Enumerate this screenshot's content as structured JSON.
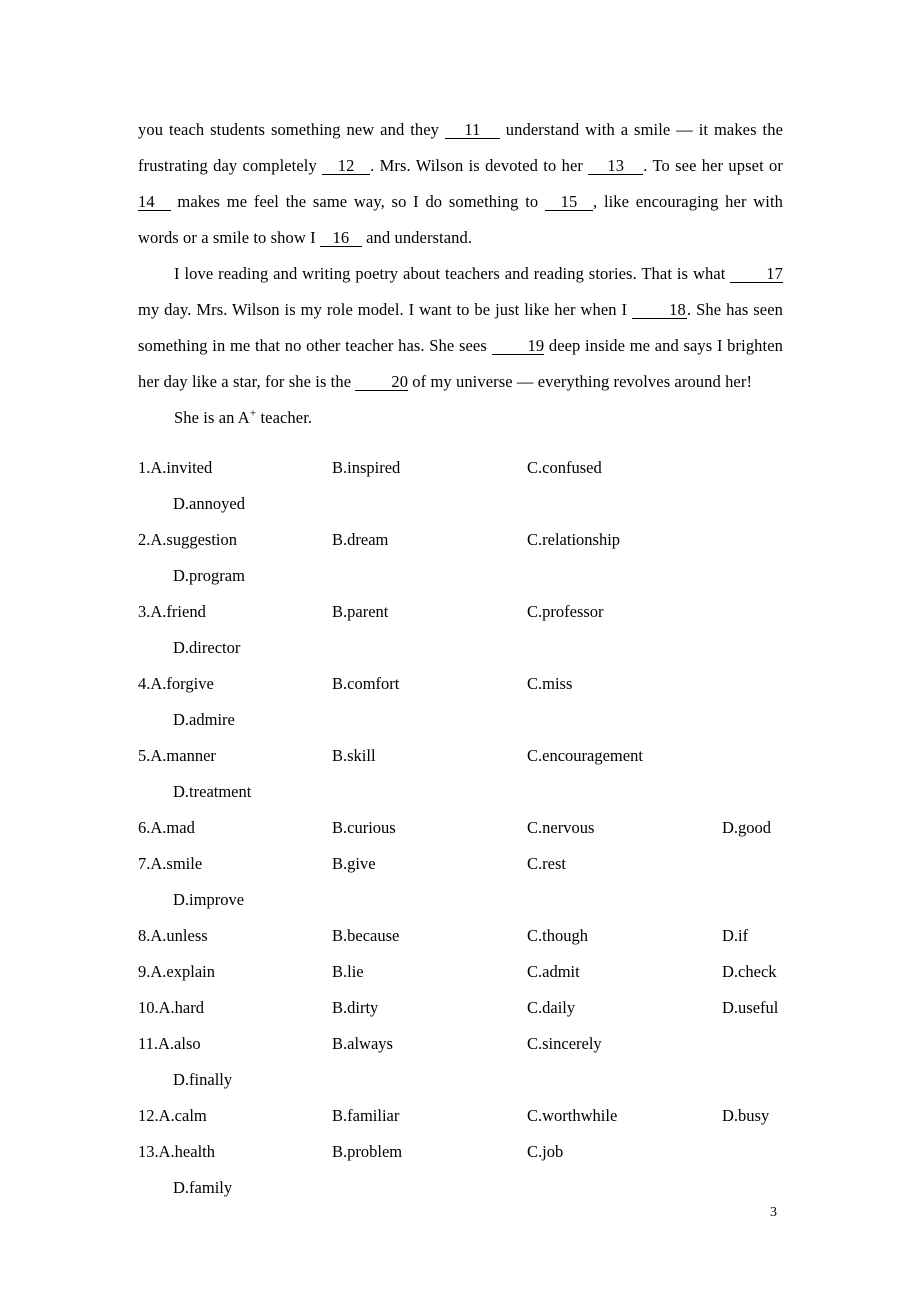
{
  "page": {
    "number": "3"
  },
  "passage": {
    "paragraphs": [
      {
        "id": "p1-continued",
        "indent": false,
        "segments": [
          {
            "type": "text",
            "text": "you teach students something new and they "
          },
          {
            "type": "blank",
            "label": "11",
            "width": "w55"
          },
          {
            "type": "text",
            "text": " understand with a smile — it makes the frustrating day completely "
          },
          {
            "type": "blank",
            "label": "12",
            "width": "w48"
          },
          {
            "type": "text",
            "text": ". Mrs. Wilson is devoted to her "
          },
          {
            "type": "blank",
            "label": "13",
            "width": "w55"
          },
          {
            "type": "text",
            "text": ". To see her upset or "
          },
          {
            "type": "blank",
            "label": "14",
            "width": "lead"
          },
          {
            "type": "text",
            "text": " makes me feel the same way, so I do something to "
          },
          {
            "type": "blank",
            "label": "15",
            "width": "w48"
          },
          {
            "type": "text",
            "text": ", like encouraging her with words or a smile to show I "
          },
          {
            "type": "blank",
            "label": "16",
            "width": "w42"
          },
          {
            "type": "text",
            "text": " and understand."
          }
        ]
      },
      {
        "id": "p2",
        "indent": true,
        "segments": [
          {
            "type": "text",
            "text": "I love reading and writing poetry about teachers and reading stories. That is what "
          },
          {
            "type": "blank",
            "label": "17",
            "width": "w48"
          },
          {
            "type": "text",
            "text": " my day. Mrs. Wilson is my role model. I want to be just like her when I "
          },
          {
            "type": "blank",
            "label": "18",
            "width": "w55"
          },
          {
            "type": "text",
            "text": ". She has seen something in me that no other teacher has. She sees "
          },
          {
            "type": "blank",
            "label": "19",
            "width": "w48"
          },
          {
            "type": "text",
            "text": " deep inside me and says I brighten her day like a star, for she is the "
          },
          {
            "type": "blank",
            "label": "20",
            "width": "w48"
          },
          {
            "type": "text",
            "text": " of my universe — everything revolves around her!"
          }
        ]
      },
      {
        "id": "p3",
        "indent": true,
        "segments": [
          {
            "type": "text",
            "text": "She is an A"
          },
          {
            "type": "sup",
            "text": "+"
          },
          {
            "type": "text",
            "text": " teacher."
          }
        ]
      }
    ]
  },
  "questions": [
    {
      "number": "1",
      "a": "1.A.invited",
      "b": "B.inspired",
      "c": "C.confused",
      "d": "D.annoyed",
      "d_wraps": true
    },
    {
      "number": "2",
      "a": "2.A.suggestion",
      "b": "B.dream",
      "c": "C.relationship",
      "d": "D.program",
      "d_wraps": true
    },
    {
      "number": "3",
      "a": "3.A.friend",
      "b": "B.parent",
      "c": "C.professor",
      "d": "D.director",
      "d_wraps": true
    },
    {
      "number": "4",
      "a": "4.A.forgive",
      "b": "B.comfort",
      "c": "C.miss",
      "d": "D.admire",
      "d_wraps": true
    },
    {
      "number": "5",
      "a": "5.A.manner",
      "b": "B.skill",
      "c": "C.encouragement",
      "d": "D.treatment",
      "d_wraps": true
    },
    {
      "number": "6",
      "a": "6.A.mad",
      "b": "B.curious",
      "c": "C.nervous",
      "d": "D.good",
      "d_wraps": false
    },
    {
      "number": "7",
      "a": "7.A.smile",
      "b": "B.give",
      "c": "C.rest",
      "d": "D.improve",
      "d_wraps": true
    },
    {
      "number": "8",
      "a": "8.A.unless",
      "b": "B.because",
      "c": "C.though",
      "d": "D.if",
      "d_wraps": false
    },
    {
      "number": "9",
      "a": "9.A.explain",
      "b": "B.lie",
      "c": "C.admit",
      "d": "D.check",
      "d_wraps": false
    },
    {
      "number": "10",
      "a": "10.A.hard",
      "b": "B.dirty",
      "c": "C.daily",
      "d": "D.useful",
      "d_wraps": false
    },
    {
      "number": "11",
      "a": "11.A.also",
      "b": "B.always",
      "c": "C.sincerely",
      "d": "D.finally",
      "d_wraps": true
    },
    {
      "number": "12",
      "a": "12.A.calm",
      "b": "B.familiar",
      "c": "C.worthwhile",
      "d": "D.busy",
      "d_wraps": false
    },
    {
      "number": "13",
      "a": "13.A.health",
      "b": "B.problem",
      "c": "C.job",
      "d": "D.family",
      "d_wraps": true
    }
  ]
}
